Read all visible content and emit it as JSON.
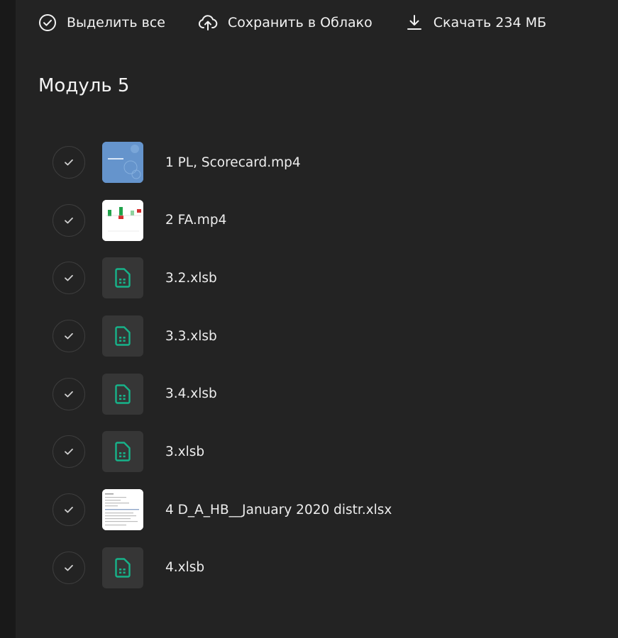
{
  "toolbar": {
    "select_all_label": "Выделить все",
    "save_cloud_label": "Сохранить в Облако",
    "download_label": "Скачать 234 МБ"
  },
  "section": {
    "title": "Модуль 5"
  },
  "files": [
    {
      "name": "1 PL, Scorecard.mp4",
      "thumb": "video-blue"
    },
    {
      "name": "2 FA.mp4",
      "thumb": "video-chart"
    },
    {
      "name": "3.2.xlsb",
      "thumb": "spreadsheet-icon"
    },
    {
      "name": "3.3.xlsb",
      "thumb": "spreadsheet-icon"
    },
    {
      "name": "3.4.xlsb",
      "thumb": "spreadsheet-icon"
    },
    {
      "name": "3.xlsb",
      "thumb": "spreadsheet-icon"
    },
    {
      "name": "4 D_A_HB__January 2020 distr.xlsx",
      "thumb": "sheet-preview"
    },
    {
      "name": "4.xlsb",
      "thumb": "spreadsheet-icon"
    }
  ],
  "colors": {
    "background": "#232323",
    "accent_green": "#17b38a",
    "text": "#ededed"
  }
}
